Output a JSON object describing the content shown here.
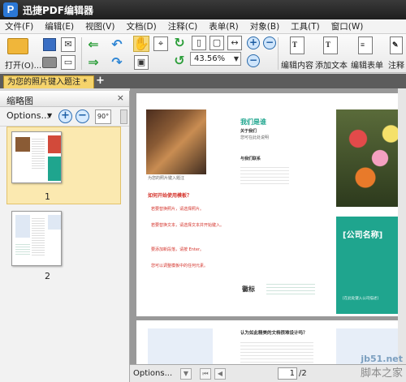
{
  "app": {
    "title": "迅捷PDF编辑器",
    "logo_letter": "P"
  },
  "menu": [
    "文件(F)",
    "编辑(E)",
    "视图(V)",
    "文档(D)",
    "注释(C)",
    "表单(R)",
    "对象(B)",
    "工具(T)",
    "窗口(W)"
  ],
  "toolbar": {
    "open_label": "打开(O)...",
    "zoom_value": "43.56%",
    "edit_content_label": "编辑内容",
    "add_text_label": "添加文本",
    "edit_form_label": "编辑表单",
    "annotate_label": "注释",
    "rotate_value": "90°"
  },
  "tab": {
    "label": "为您的照片键入题注 *",
    "add": "+",
    "close": "×"
  },
  "sidebar": {
    "title": "缩略图",
    "options_label": "Options...",
    "close": "×",
    "thumbnails": [
      {
        "page": "1"
      },
      {
        "page": "2"
      }
    ]
  },
  "page1": {
    "heading": "我们是谁",
    "about_heading": "关于我们",
    "about_text": "您可在此处说明",
    "contact_heading": "与我们联系",
    "howto_heading": "如何开始使用模板？",
    "bullets": [
      "若要替换照片，请选择照片。",
      "若要替换文本，请选择文本并开始键入。",
      "要添加新段落，请按 Enter。",
      "您可以调整模板中的任何元素。"
    ],
    "logo_label": "徽标",
    "company_name": "[公司名称]",
    "company_sub": "[在此处键入公司描述]"
  },
  "page2": {
    "heading": "认为如此精美的文档很难设计吗？"
  },
  "status": {
    "options_label": "Options...",
    "current_page": "1",
    "total_pages": "/2"
  },
  "watermark": {
    "line1": "jb51.net",
    "line2": "脚本之家"
  },
  "colors": {
    "teal": "#1fa58e",
    "tab_yellow": "#f5d36b",
    "heading_green": "#1fa58e",
    "red_text": "#d4332b"
  }
}
